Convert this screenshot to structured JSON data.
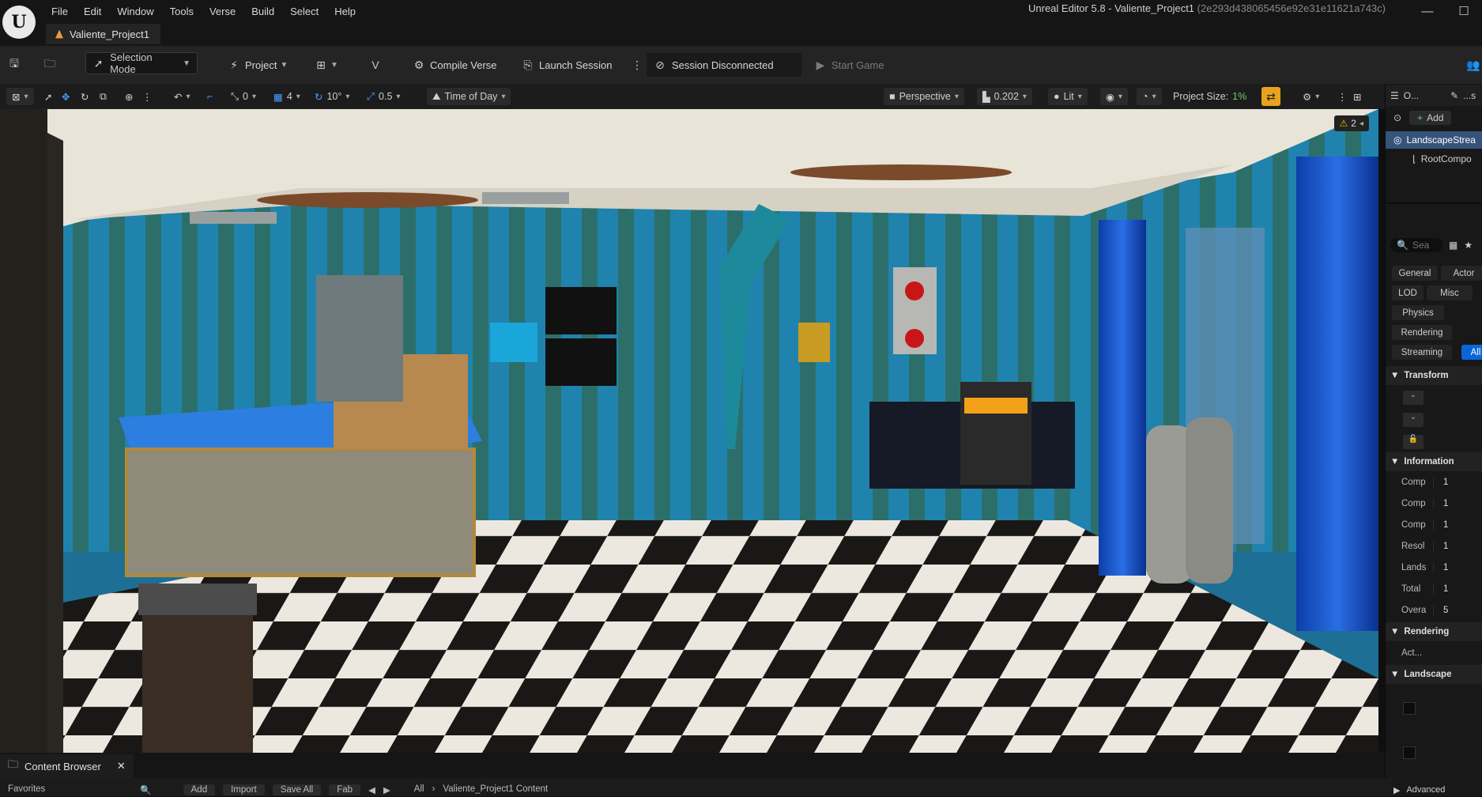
{
  "app": {
    "logo_letter": "U",
    "window_title": "Unreal Editor 5.8 - Valiente_Project1",
    "window_hash": "(2e293d438065456e92e31e11621a743c)",
    "doc_tab": "Valiente_Project1"
  },
  "menu": [
    "File",
    "Edit",
    "Window",
    "Tools",
    "Verse",
    "Build",
    "Select",
    "Help"
  ],
  "toolbar": {
    "selection_mode": "Selection Mode",
    "project": "Project",
    "compile_verse": "Compile Verse",
    "launch_session": "Launch Session",
    "session_status": "Session Disconnected",
    "start_game": "Start Game"
  },
  "viewport_toolbar": {
    "rotate_snap_count": "0",
    "grid_snap": "4",
    "angle_snap": "10°",
    "scale_snap": "0.5",
    "time_of_day": "Time of Day",
    "view_mode": "Perspective",
    "camera_speed": "0.202",
    "lighting": "Lit",
    "project_size_label": "Project Size:",
    "project_size_value": "1%"
  },
  "viewport": {
    "warning_count": "2"
  },
  "right_panel": {
    "outliner_tab": "O...",
    "details_tab": "...s",
    "add_label": "Add",
    "actor_name": "LandscapeStrea",
    "root_component": "RootCompo",
    "search_placeholder": "Sea",
    "categories": [
      "General",
      "Actor",
      "LOD",
      "Misc",
      "Physics",
      "Rendering",
      "Streaming",
      "All"
    ],
    "sections": {
      "transform": "Transform",
      "information": "Information",
      "rendering": "Rendering",
      "landscape": "Landscape",
      "advanced": "Advanced"
    },
    "info_rows": [
      {
        "label": "Comp",
        "value": "1"
      },
      {
        "label": "Comp",
        "value": "1"
      },
      {
        "label": "Comp",
        "value": "1"
      },
      {
        "label": "Resol",
        "value": "1"
      },
      {
        "label": "Lands",
        "value": "1"
      },
      {
        "label": "Total",
        "value": "1"
      },
      {
        "label": "Overa",
        "value": "5"
      }
    ],
    "rendering_row": "Act..."
  },
  "content_browser": {
    "tab": "Content Browser",
    "favorites": "Favorites",
    "add": "Add",
    "import": "Import",
    "save_all": "Save All",
    "fab": "Fab",
    "path_all": "All",
    "path_project": "Valiente_Project1 Content"
  },
  "colors": {
    "accent_blue": "#0a66d8",
    "accent_orange": "#e8a21d",
    "project_size_green": "#6ad06a"
  }
}
